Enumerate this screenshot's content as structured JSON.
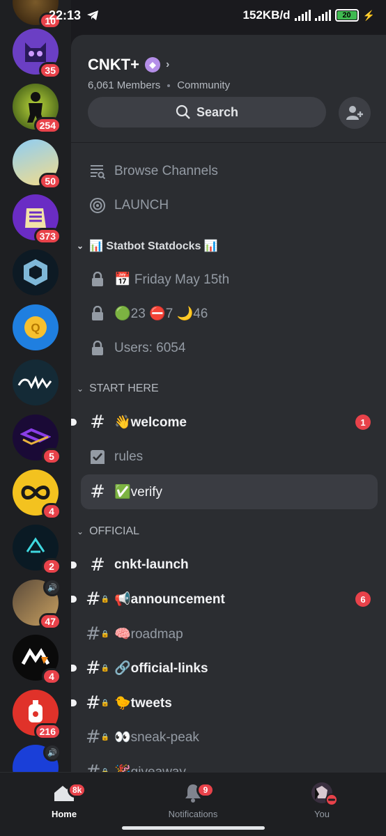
{
  "status": {
    "time": "22:13",
    "speed": "152KB/d",
    "battery": "20"
  },
  "server": {
    "name": "CNKT+",
    "members": "6,061 Members",
    "type": "Community",
    "search_label": "Search"
  },
  "rail_badges": [
    "10",
    "35",
    "254",
    "50",
    "373",
    "5",
    "4",
    "2",
    "47",
    "4",
    "216"
  ],
  "channels": {
    "browse": "Browse Channels",
    "launch": "LAUNCH",
    "stat_category": "📊 Statbot Statdocks 📊",
    "stat_date": "📅 Friday May 15th",
    "stat_status": "🟢23 ⛔7 🌙46",
    "stat_users": "Users: 6054",
    "start_category": "START HERE",
    "welcome": "👋welcome",
    "welcome_count": "1",
    "rules": "rules",
    "verify": "✅verify",
    "official_category": "OFFICIAL",
    "cnkt_launch": "cnkt-launch",
    "announcement": "📢announcement",
    "announcement_count": "6",
    "roadmap": "🧠roadmap",
    "official_links": "🔗official-links",
    "tweets": "🐤tweets",
    "sneak_peak": "👀sneak-peak",
    "giveaway": "🎉giveaway"
  },
  "nav": {
    "home": "Home",
    "home_badge": "8k",
    "notifications": "Notifications",
    "notifications_badge": "9",
    "you": "You"
  }
}
